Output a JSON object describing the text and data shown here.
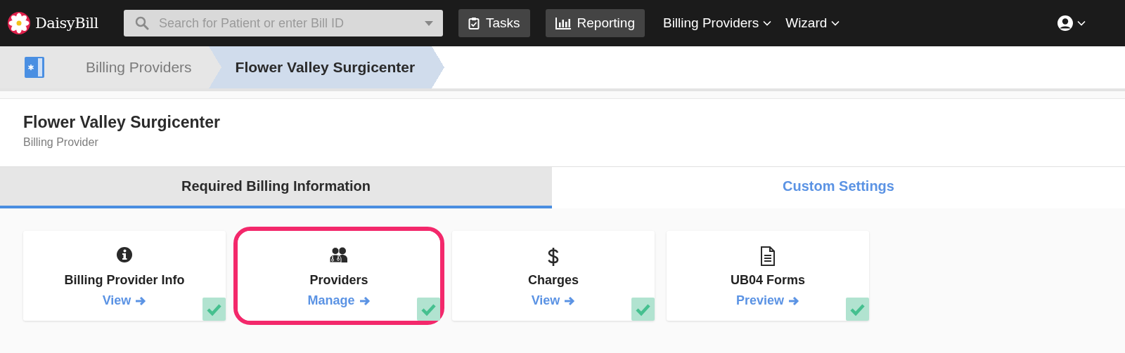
{
  "topbar": {
    "logo": "DaisyBill",
    "search": {
      "placeholder": "Search for Patient or enter Bill ID"
    },
    "buttons": [
      {
        "label": "Tasks",
        "kind": "tasks"
      },
      {
        "label": "Reporting",
        "kind": "reporting"
      }
    ],
    "menus": [
      "Billing Providers",
      "Wizard"
    ]
  },
  "breadcrumb": [
    {
      "label": "Billing Providers",
      "selected": false
    },
    {
      "label": "Flower Valley Surgicenter",
      "selected": true
    }
  ],
  "header": {
    "title": "Flower Valley Surgicenter",
    "subtitle": "Billing Provider"
  },
  "tabs": [
    {
      "label": "Required Billing Information",
      "selected": true
    },
    {
      "label": "Custom Settings",
      "selected": false
    }
  ],
  "cards": [
    {
      "kind": "info",
      "title": "Billing Provider Info",
      "link": "View",
      "checked": true,
      "highlighted": false
    },
    {
      "kind": "providers",
      "title": "Providers",
      "link": "Manage",
      "checked": true,
      "highlighted": true
    },
    {
      "kind": "charges",
      "title": "Charges",
      "link": "View",
      "checked": true,
      "highlighted": false
    },
    {
      "kind": "forms",
      "title": "UB04 Forms",
      "link": "Preview",
      "checked": true,
      "highlighted": false
    }
  ]
}
